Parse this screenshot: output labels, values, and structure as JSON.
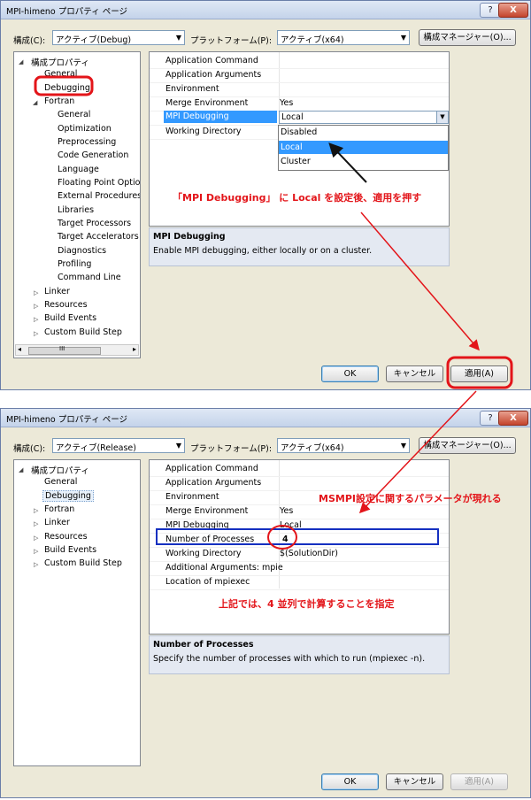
{
  "dialog1": {
    "title": "MPI-himeno プロパティ ページ",
    "help_label": "?",
    "close_label": "X",
    "config_label": "構成(C):",
    "config_value": "アクティブ(Debug)",
    "platform_label": "プラットフォーム(P):",
    "platform_value": "アクティブ(x64)",
    "config_manager_label": "構成マネージャー(O)...",
    "tree": [
      "構成プロパティ",
      "General",
      "Debugging",
      "Fortran",
      "General",
      "Optimization",
      "Preprocessing",
      "Code Generation",
      "Language",
      "Floating Point Options",
      "External Procedures",
      "Libraries",
      "Target Processors",
      "Target Accelerators",
      "Diagnostics",
      "Profiling",
      "Command Line",
      "Linker",
      "Resources",
      "Build Events",
      "Custom Build Step"
    ],
    "scroll_thumb": "III",
    "properties": [
      {
        "name": "Application Command",
        "value": ""
      },
      {
        "name": "Application Arguments",
        "value": ""
      },
      {
        "name": "Environment",
        "value": ""
      },
      {
        "name": "Merge Environment",
        "value": "Yes"
      },
      {
        "name": "MPI Debugging",
        "value": "Local"
      },
      {
        "name": "Working Directory",
        "value": ""
      }
    ],
    "dropdown_options": [
      "Disabled",
      "Local",
      "Cluster"
    ],
    "description_title": "MPI Debugging",
    "description_text": "Enable MPI debugging, either locally or on a cluster.",
    "ok_label": "OK",
    "cancel_label": "キャンセル",
    "apply_label": "適用(A)"
  },
  "dialog2": {
    "title": "MPI-himeno プロパティ ページ",
    "help_label": "?",
    "close_label": "X",
    "config_label": "構成(C):",
    "config_value": "アクティブ(Release)",
    "platform_label": "プラットフォーム(P):",
    "platform_value": "アクティブ(x64)",
    "config_manager_label": "構成マネージャー(O)...",
    "tree": [
      "構成プロパティ",
      "General",
      "Debugging",
      "Fortran",
      "Linker",
      "Resources",
      "Build Events",
      "Custom Build Step"
    ],
    "properties": [
      {
        "name": "Application Command",
        "value": ""
      },
      {
        "name": "Application Arguments",
        "value": ""
      },
      {
        "name": "Environment",
        "value": ""
      },
      {
        "name": "Merge Environment",
        "value": "Yes"
      },
      {
        "name": "MPI Debugging",
        "value": "Local"
      },
      {
        "name": "Number of Processes",
        "value": "4"
      },
      {
        "name": "Working Directory",
        "value": "$(SolutionDir)"
      },
      {
        "name": "Additional Arguments: mpie",
        "value": ""
      },
      {
        "name": "Location of mpiexec",
        "value": ""
      }
    ],
    "description_title": "Number of Processes",
    "description_text": "Specify the number of processes with which to run (mpiexec -n).",
    "ok_label": "OK",
    "cancel_label": "キャンセル",
    "apply_label": "適用(A)"
  },
  "annotations": {
    "note1": "「MPI Debugging」 に Local を設定後、適用を押す",
    "note2": "MSMPI設定に関するパラメータが現れる",
    "note3": "上記では、4 並列で計算することを指定"
  },
  "colors": {
    "annotation_red": "#e3151a",
    "highlight_blue": "#1530c0",
    "selection_blue": "#3399ff"
  }
}
